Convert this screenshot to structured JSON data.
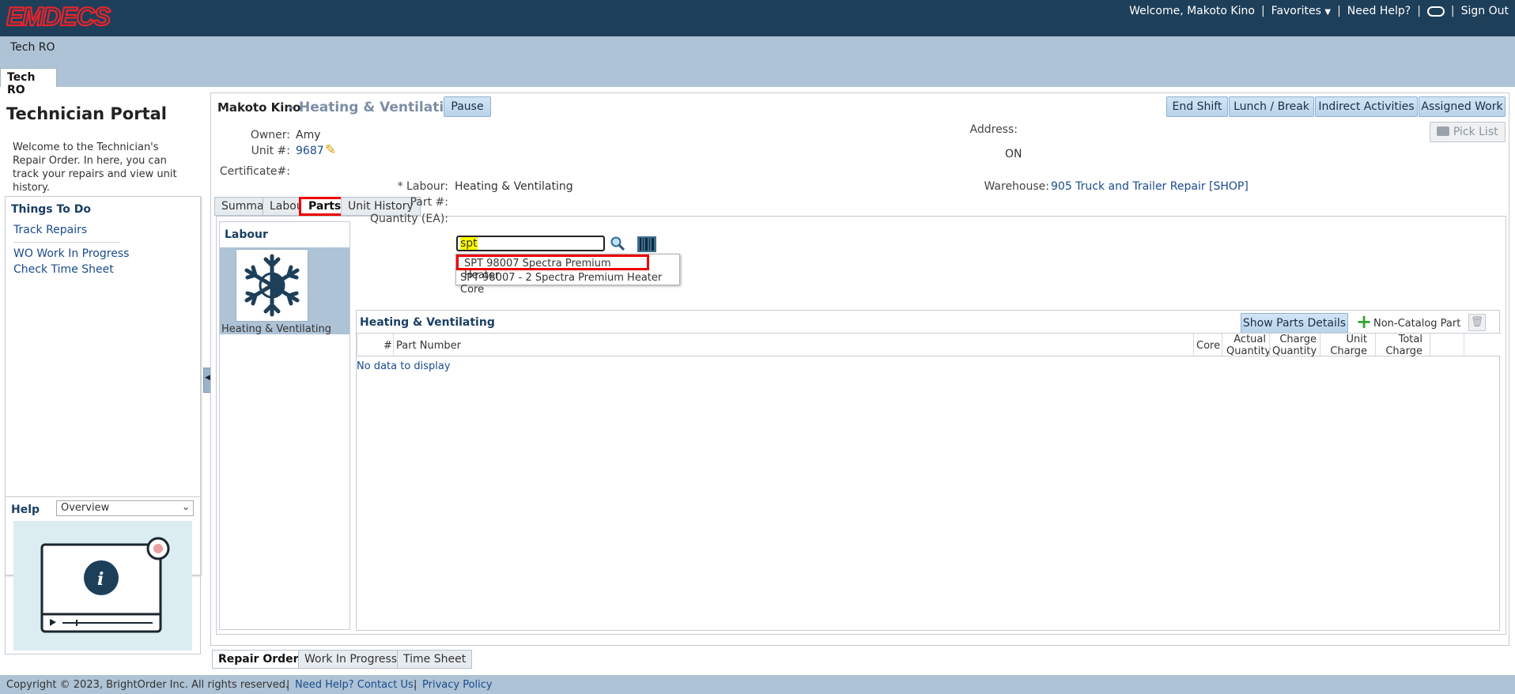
{
  "app": {
    "logo_text": "EMDECS",
    "welcome": "Welcome, Makoto Kino",
    "favorites": "Favorites",
    "need_help": "Need Help?",
    "sign_out": "Sign Out"
  },
  "nav": {
    "breadcrumb": "Tech RO",
    "tab_label": "Tech RO"
  },
  "left": {
    "title": "Technician Portal",
    "description": "Welcome to the Technician's Repair Order. In here, you can track your repairs and view unit history.",
    "todo_title": "Things To Do",
    "todo_items": [
      "Track Repairs",
      "WO Work In Progress",
      "Check Time Sheet"
    ],
    "help_title": "Help",
    "help_selected": "Overview"
  },
  "header": {
    "tech_name": "Makoto Kino",
    "job": "- Heating & Ventilating",
    "pause": "Pause",
    "buttons": [
      "End Shift",
      "Lunch / Break",
      "Indirect Activities",
      "Assigned Work"
    ],
    "pick_list": "Pick List"
  },
  "info": {
    "owner_label": "Owner:",
    "owner": "Amy",
    "unit_label": "Unit #:",
    "unit": "9687",
    "cert_label": "Certificate#:",
    "cert": "",
    "address_label": "Address:",
    "address": "ON"
  },
  "tabs": [
    "Summary",
    "Labour",
    "Parts",
    "Unit History"
  ],
  "labour_list": {
    "header": "Labour",
    "item": "Heating & Ventilating"
  },
  "parts_form": {
    "labour_label": "* Labour:",
    "labour_value": "Heating & Ventilating",
    "part_label": "Part #:",
    "part_value": "spt",
    "qty_label": "Quantity (EA):",
    "warehouse_label": "Warehouse:",
    "warehouse_value": "905 Truck and Trailer Repair [SHOP]",
    "suggestions": [
      "SPT 98007 Spectra Premium Heater",
      "SPT 98007 - 2 Spectra Premium Heater Core"
    ]
  },
  "parts_table": {
    "title": "Heating & Ventilating",
    "show_details": "Show Parts Details",
    "non_catalog": "Non-Catalog Part",
    "columns": [
      "#",
      "Part Number",
      "Core",
      "Actual Quantity",
      "Charge Quantity",
      "Unit Charge",
      "Total Charge"
    ],
    "empty": "No data to display"
  },
  "bottom_tabs": [
    "Repair Order",
    "Work In Progress",
    "Time Sheet"
  ],
  "footer": {
    "copyright": "Copyright © 2023, BrightOrder Inc. All rights reserved.",
    "help_link": "Need Help? Contact Us.",
    "privacy": "Privacy Policy"
  },
  "colors": {
    "header_bg": "#1e3f5a",
    "nav_bg": "#aec3d6",
    "logo_red": "#e8232a",
    "highlight_red": "#e00000",
    "search_highlight": "#ffff00"
  }
}
